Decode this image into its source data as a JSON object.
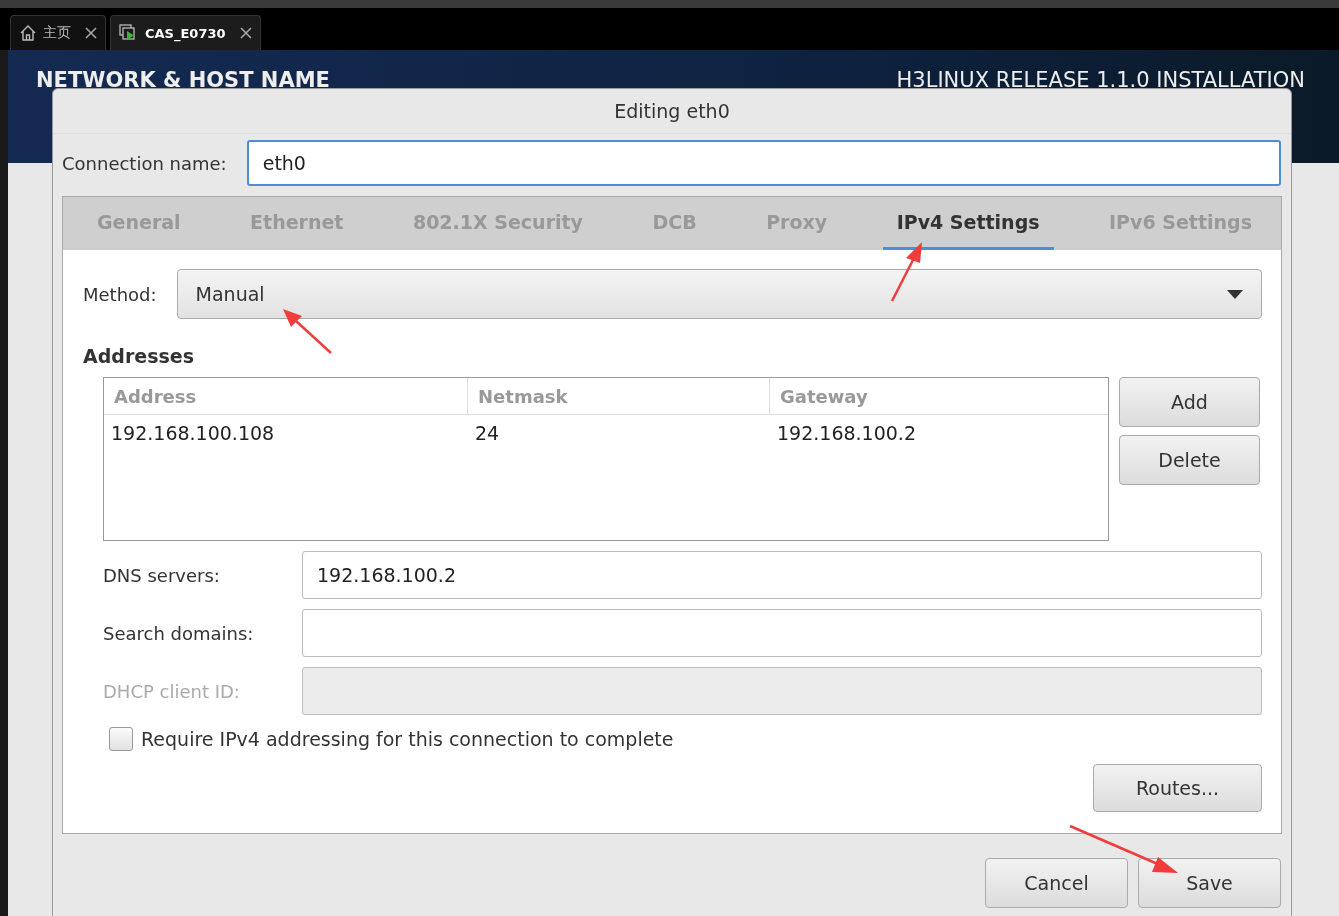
{
  "browser_tabs": [
    {
      "label": "主页",
      "selected": false
    },
    {
      "label": "CAS_E0730",
      "selected": true
    }
  ],
  "installer": {
    "heading": "NETWORK & HOST NAME",
    "release": "H3LINUX RELEASE 1.1.0 INSTALLATION"
  },
  "dialog": {
    "title": "Editing eth0",
    "connection_name": {
      "label": "Connection name:",
      "value": "eth0"
    },
    "tabs": [
      {
        "label": "General",
        "selected": false
      },
      {
        "label": "Ethernet",
        "selected": false
      },
      {
        "label": "802.1X Security",
        "selected": false
      },
      {
        "label": "DCB",
        "selected": false
      },
      {
        "label": "Proxy",
        "selected": false
      },
      {
        "label": "IPv4 Settings",
        "selected": true
      },
      {
        "label": "IPv6 Settings",
        "selected": false
      }
    ],
    "method": {
      "label": "Method:",
      "value": "Manual"
    },
    "addresses": {
      "title": "Addresses",
      "columns": [
        "Address",
        "Netmask",
        "Gateway"
      ],
      "rows": [
        [
          "192.168.100.108",
          "24",
          "192.168.100.2"
        ]
      ],
      "buttons": [
        "Add",
        "Delete"
      ]
    },
    "fields": [
      {
        "label": "DNS servers:",
        "value": "192.168.100.2",
        "disabled": false
      },
      {
        "label": "Search domains:",
        "disabled": false
      },
      {
        "label": "DHCP client ID:",
        "disabled": true
      }
    ],
    "require_ipv4": {
      "label": "Require IPv4 addressing for this connection to complete",
      "checked": false
    },
    "routes_button": "Routes...",
    "buttons": [
      "Cancel",
      "Save"
    ]
  }
}
